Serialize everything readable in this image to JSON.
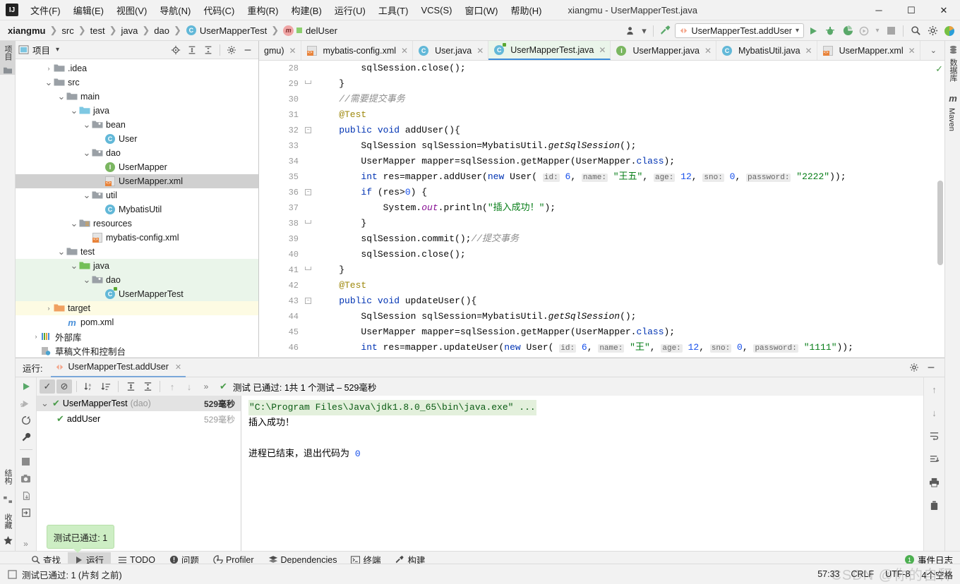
{
  "window": {
    "title": "xiangmu - UserMapperTest.java",
    "minimize": "─",
    "maximize": "☐",
    "close": "✕",
    "logo": "IJ"
  },
  "menu": {
    "items": [
      "文件(F)",
      "编辑(E)",
      "视图(V)",
      "导航(N)",
      "代码(C)",
      "重构(R)",
      "构建(B)",
      "运行(U)",
      "工具(T)",
      "VCS(S)",
      "窗口(W)",
      "帮助(H)"
    ]
  },
  "breadcrumb": {
    "items": [
      {
        "label": "xiangmu",
        "icon": "",
        "bold": true
      },
      {
        "label": "src",
        "icon": ""
      },
      {
        "label": "test",
        "icon": ""
      },
      {
        "label": "java",
        "icon": ""
      },
      {
        "label": "dao",
        "icon": ""
      },
      {
        "label": "UserMapperTest",
        "icon": "class-icon"
      },
      {
        "label": "delUser",
        "icon": "method-icon"
      }
    ],
    "separator": "❯"
  },
  "navbar_right": {
    "profile_icon": "user-icon",
    "chevron": "▾",
    "build_icon": "hammer-icon",
    "run_config": "UserMapperTest.addUser",
    "run_config_chevron": "▾",
    "run_icon": "run-icon",
    "debug_icon": "debug-icon",
    "coverage_icon": "coverage-icon",
    "profile_run_icon": "profile-run-icon",
    "stop_icon": "stop-icon",
    "search_icon": "search-icon",
    "settings_icon": "gear-icon",
    "account_icon": "account-icon"
  },
  "left_strip": {
    "tabs": [
      {
        "label": "项目",
        "active": true,
        "icon": "project-icon"
      },
      {
        "label": "结构",
        "active": false,
        "icon": "structure-icon"
      },
      {
        "label": "收藏",
        "active": false,
        "icon": "star-icon"
      }
    ]
  },
  "right_strip": {
    "tabs": [
      {
        "label": "数据库",
        "icon": "database-icon"
      },
      {
        "label": "Maven",
        "icon": "maven-icon"
      }
    ]
  },
  "project_panel": {
    "title": "项目",
    "chevron": "▾",
    "icons": [
      "locate-icon",
      "expand-all-icon",
      "collapse-all-icon",
      "gear-icon",
      "hide-icon"
    ],
    "tree": [
      {
        "label": ".idea",
        "depth": 2,
        "arrow": "›",
        "icon": "folder-gray"
      },
      {
        "label": "src",
        "depth": 2,
        "arrow": "⌄",
        "icon": "folder-gray"
      },
      {
        "label": "main",
        "depth": 3,
        "arrow": "⌄",
        "icon": "folder-gray"
      },
      {
        "label": "java",
        "depth": 4,
        "arrow": "⌄",
        "icon": "folder-blue"
      },
      {
        "label": "bean",
        "depth": 5,
        "arrow": "⌄",
        "icon": "folder-pkg"
      },
      {
        "label": "User",
        "depth": 6,
        "arrow": "",
        "icon": "class-icon"
      },
      {
        "label": "dao",
        "depth": 5,
        "arrow": "⌄",
        "icon": "folder-pkg"
      },
      {
        "label": "UserMapper",
        "depth": 6,
        "arrow": "",
        "icon": "interface-icon"
      },
      {
        "label": "UserMapper.xml",
        "depth": 6,
        "arrow": "",
        "icon": "xml-icon",
        "selected": true
      },
      {
        "label": "util",
        "depth": 5,
        "arrow": "⌄",
        "icon": "folder-pkg"
      },
      {
        "label": "MybatisUtil",
        "depth": 6,
        "arrow": "",
        "icon": "class-icon"
      },
      {
        "label": "resources",
        "depth": 4,
        "arrow": "⌄",
        "icon": "folder-resources"
      },
      {
        "label": "mybatis-config.xml",
        "depth": 5,
        "arrow": "",
        "icon": "xml-icon"
      },
      {
        "label": "test",
        "depth": 3,
        "arrow": "⌄",
        "icon": "folder-gray"
      },
      {
        "label": "java",
        "depth": 4,
        "arrow": "⌄",
        "icon": "folder-green",
        "testsrc": true
      },
      {
        "label": "dao",
        "depth": 5,
        "arrow": "⌄",
        "icon": "folder-pkg",
        "testsrc": true
      },
      {
        "label": "UserMapperTest",
        "depth": 6,
        "arrow": "",
        "icon": "test-class-icon",
        "testsrc": true
      },
      {
        "label": "target",
        "depth": 2,
        "arrow": "›",
        "icon": "folder-orange",
        "generated": true
      },
      {
        "label": "pom.xml",
        "depth": 3,
        "arrow": "",
        "icon": "maven-icon"
      },
      {
        "label": "外部库",
        "depth": 1,
        "arrow": "›",
        "icon": "library-icon"
      },
      {
        "label": "草稿文件和控制台",
        "depth": 1,
        "arrow": "",
        "icon": "scratch-icon"
      }
    ]
  },
  "editor": {
    "tabs": [
      {
        "label": "gmu)",
        "icon": "generic-icon",
        "active": false,
        "truncated": true
      },
      {
        "label": "mybatis-config.xml",
        "icon": "xml-icon",
        "active": false
      },
      {
        "label": "User.java",
        "icon": "class-icon",
        "active": false
      },
      {
        "label": "UserMapperTest.java",
        "icon": "test-class-icon",
        "active": true
      },
      {
        "label": "UserMapper.java",
        "icon": "interface-icon",
        "active": false
      },
      {
        "label": "MybatisUtil.java",
        "icon": "class-icon",
        "active": false
      },
      {
        "label": "UserMapper.xml",
        "icon": "xml-icon",
        "active": false
      }
    ],
    "tab_close": "✕",
    "tab_overflow": "⌄",
    "first_line_number": 28,
    "lines": [
      {
        "n": 28,
        "fold": "",
        "run": false,
        "tokens": [
          {
            "t": "        sqlSession.close();",
            "c": ""
          }
        ]
      },
      {
        "n": 29,
        "fold": "end",
        "run": false,
        "tokens": [
          {
            "t": "    }",
            "c": ""
          }
        ]
      },
      {
        "n": 30,
        "fold": "",
        "run": false,
        "tokens": [
          {
            "t": "    //需要提交事务",
            "c": "cmt"
          }
        ]
      },
      {
        "n": 31,
        "fold": "",
        "run": false,
        "tokens": [
          {
            "t": "    @Test",
            "c": "ann"
          }
        ]
      },
      {
        "n": 32,
        "fold": "start",
        "run": true,
        "tokens": [
          {
            "t": "    ",
            "c": ""
          },
          {
            "t": "public",
            "c": "kw"
          },
          {
            "t": " ",
            "c": ""
          },
          {
            "t": "void",
            "c": "kw"
          },
          {
            "t": " ",
            "c": ""
          },
          {
            "t": "addUser",
            "c": "mth"
          },
          {
            "t": "(){",
            "c": ""
          }
        ]
      },
      {
        "n": 33,
        "fold": "",
        "run": false,
        "tokens": [
          {
            "t": "        SqlSession sqlSession=MybatisUtil.",
            "c": ""
          },
          {
            "t": "getSqlSession",
            "c": "it"
          },
          {
            "t": "();",
            "c": ""
          }
        ]
      },
      {
        "n": 34,
        "fold": "",
        "run": false,
        "tokens": [
          {
            "t": "        UserMapper mapper=sqlSession.getMapper(UserMapper.",
            "c": ""
          },
          {
            "t": "class",
            "c": "kw"
          },
          {
            "t": ");",
            "c": ""
          }
        ]
      },
      {
        "n": 35,
        "fold": "",
        "run": false,
        "tokens": [
          {
            "t": "        ",
            "c": ""
          },
          {
            "t": "int",
            "c": "kw"
          },
          {
            "t": " res=mapper.addUser(",
            "c": ""
          },
          {
            "t": "new",
            "c": "kw"
          },
          {
            "t": " User( ",
            "c": ""
          },
          {
            "t": "id:",
            "c": "hint"
          },
          {
            "t": " ",
            "c": ""
          },
          {
            "t": "6",
            "c": "num"
          },
          {
            "t": ", ",
            "c": ""
          },
          {
            "t": "name:",
            "c": "hint"
          },
          {
            "t": " ",
            "c": ""
          },
          {
            "t": "\"王五\"",
            "c": "str"
          },
          {
            "t": ", ",
            "c": ""
          },
          {
            "t": "age:",
            "c": "hint"
          },
          {
            "t": " ",
            "c": ""
          },
          {
            "t": "12",
            "c": "num"
          },
          {
            "t": ", ",
            "c": ""
          },
          {
            "t": "sno:",
            "c": "hint"
          },
          {
            "t": " ",
            "c": ""
          },
          {
            "t": "0",
            "c": "num"
          },
          {
            "t": ", ",
            "c": ""
          },
          {
            "t": "password:",
            "c": "hint"
          },
          {
            "t": " ",
            "c": ""
          },
          {
            "t": "\"2222\"",
            "c": "str"
          },
          {
            "t": "));",
            "c": ""
          }
        ]
      },
      {
        "n": 36,
        "fold": "start",
        "run": false,
        "tokens": [
          {
            "t": "        ",
            "c": ""
          },
          {
            "t": "if",
            "c": "kw"
          },
          {
            "t": " (res>",
            "c": ""
          },
          {
            "t": "0",
            "c": "num"
          },
          {
            "t": ") {",
            "c": ""
          }
        ]
      },
      {
        "n": 37,
        "fold": "",
        "run": false,
        "tokens": [
          {
            "t": "            System.",
            "c": ""
          },
          {
            "t": "out",
            "c": "fld"
          },
          {
            "t": ".println(",
            "c": ""
          },
          {
            "t": "\"插入成功！\"",
            "c": "str"
          },
          {
            "t": ");",
            "c": ""
          }
        ]
      },
      {
        "n": 38,
        "fold": "end",
        "run": false,
        "tokens": [
          {
            "t": "        }",
            "c": ""
          }
        ]
      },
      {
        "n": 39,
        "fold": "",
        "run": false,
        "tokens": [
          {
            "t": "        sqlSession.commit();",
            "c": ""
          },
          {
            "t": "//提交事务",
            "c": "cmt"
          }
        ]
      },
      {
        "n": 40,
        "fold": "",
        "run": false,
        "tokens": [
          {
            "t": "        sqlSession.close();",
            "c": ""
          }
        ]
      },
      {
        "n": 41,
        "fold": "end",
        "run": false,
        "tokens": [
          {
            "t": "    }",
            "c": ""
          }
        ]
      },
      {
        "n": 42,
        "fold": "",
        "run": false,
        "tokens": [
          {
            "t": "    @Test",
            "c": "ann"
          }
        ]
      },
      {
        "n": 43,
        "fold": "start",
        "run": true,
        "tokens": [
          {
            "t": "    ",
            "c": ""
          },
          {
            "t": "public",
            "c": "kw"
          },
          {
            "t": " ",
            "c": ""
          },
          {
            "t": "void",
            "c": "kw"
          },
          {
            "t": " ",
            "c": ""
          },
          {
            "t": "updateUser",
            "c": "mth"
          },
          {
            "t": "(){",
            "c": ""
          }
        ]
      },
      {
        "n": 44,
        "fold": "",
        "run": false,
        "tokens": [
          {
            "t": "        SqlSession sqlSession=MybatisUtil.",
            "c": ""
          },
          {
            "t": "getSqlSession",
            "c": "it"
          },
          {
            "t": "();",
            "c": ""
          }
        ]
      },
      {
        "n": 45,
        "fold": "",
        "run": false,
        "tokens": [
          {
            "t": "        UserMapper mapper=sqlSession.getMapper(UserMapper.",
            "c": ""
          },
          {
            "t": "class",
            "c": "kw"
          },
          {
            "t": ");",
            "c": ""
          }
        ]
      },
      {
        "n": 46,
        "fold": "",
        "run": false,
        "tokens": [
          {
            "t": "        ",
            "c": ""
          },
          {
            "t": "int",
            "c": "kw"
          },
          {
            "t": " res=mapper.updateUser(",
            "c": ""
          },
          {
            "t": "new",
            "c": "kw"
          },
          {
            "t": " User( ",
            "c": ""
          },
          {
            "t": "id:",
            "c": "hint"
          },
          {
            "t": " ",
            "c": ""
          },
          {
            "t": "6",
            "c": "num"
          },
          {
            "t": ", ",
            "c": ""
          },
          {
            "t": "name:",
            "c": "hint"
          },
          {
            "t": " ",
            "c": ""
          },
          {
            "t": "\"王\"",
            "c": "str"
          },
          {
            "t": ", ",
            "c": ""
          },
          {
            "t": "age:",
            "c": "hint"
          },
          {
            "t": " ",
            "c": ""
          },
          {
            "t": "12",
            "c": "num"
          },
          {
            "t": ", ",
            "c": ""
          },
          {
            "t": "sno:",
            "c": "hint"
          },
          {
            "t": " ",
            "c": ""
          },
          {
            "t": "0",
            "c": "num"
          },
          {
            "t": ", ",
            "c": ""
          },
          {
            "t": "password:",
            "c": "hint"
          },
          {
            "t": " ",
            "c": ""
          },
          {
            "t": "\"1111\"",
            "c": "str"
          },
          {
            "t": "));",
            "c": ""
          }
        ]
      }
    ]
  },
  "run_panel": {
    "label": "运行:",
    "tab_label": "UserMapperTest.addUser",
    "tab_close": "✕",
    "settings_icon": "gear-icon",
    "hide_icon": "hide-icon",
    "toolbar": {
      "rerun": "run-icon",
      "show_passed": "check-icon",
      "show_ignored": "ignored-icon",
      "sort_alpha": "sort-alpha-icon",
      "sort_duration": "sort-duration-icon",
      "expand_all": "expand-all-icon",
      "collapse_all": "collapse-all-icon",
      "prev": "↑",
      "next": "↓",
      "more": "»",
      "status": "测试 已通过: 1共 1 个测试 – 529毫秒",
      "status_check": "✔"
    },
    "left_tools": [
      "run-icon",
      "rerun-failed-icon",
      "restart-icon",
      "settings-wrench-icon",
      "stop-icon",
      "screenshot-icon",
      "export-icon",
      "import-icon",
      "more-icon"
    ],
    "right_tools": [
      "↑",
      "↓",
      "soft-wrap-icon",
      "scroll-end-icon",
      "print-icon",
      "trash-icon"
    ],
    "test_tree": [
      {
        "name": "UserMapperTest",
        "pkg": "(dao)",
        "time": "529毫秒",
        "depth": 0,
        "selected": true,
        "arrow": "⌄"
      },
      {
        "name": "addUser",
        "pkg": "",
        "time": "529毫秒",
        "depth": 1,
        "selected": false,
        "arrow": ""
      }
    ],
    "console": [
      {
        "text": "\"C:\\Program Files\\Java\\jdk1.8.0_65\\bin\\java.exe\" ...",
        "style": "cmd"
      },
      {
        "text": "插入成功！",
        "style": "out"
      },
      {
        "text": "",
        "style": "out"
      },
      {
        "text": "进程已结束，退出代码为 0",
        "style": "exit"
      }
    ]
  },
  "tooltip": {
    "text": "测试已通过: 1"
  },
  "bottom_strip": {
    "tabs": [
      {
        "label": "查找",
        "icon": "search-icon",
        "active": false
      },
      {
        "label": "运行",
        "icon": "run-icon",
        "active": true
      },
      {
        "label": "TODO",
        "icon": "todo-icon",
        "active": false
      },
      {
        "label": "问题",
        "icon": "problems-icon",
        "active": false
      },
      {
        "label": "Profiler",
        "icon": "profiler-icon",
        "active": false
      },
      {
        "label": "Dependencies",
        "icon": "dependencies-icon",
        "active": false
      },
      {
        "label": "终端",
        "icon": "terminal-icon",
        "active": false
      },
      {
        "label": "构建",
        "icon": "build-icon",
        "active": false
      }
    ],
    "event_log": {
      "count": "1",
      "label": "事件日志"
    }
  },
  "statusbar": {
    "message": "测试已通过: 1 (片刻 之前)",
    "message_icon": "notification-icon",
    "caret": "57:33",
    "line_sep": "CRLF",
    "encoding": "UTF-8",
    "indent": "4个空格",
    "watermark": "CSDN @你的自释"
  },
  "colors": {
    "accent_green": "#4caf50",
    "accent_blue": "#3c8ddb",
    "test_bg": "#eaf5ea",
    "selection": "#d0d0d0"
  }
}
